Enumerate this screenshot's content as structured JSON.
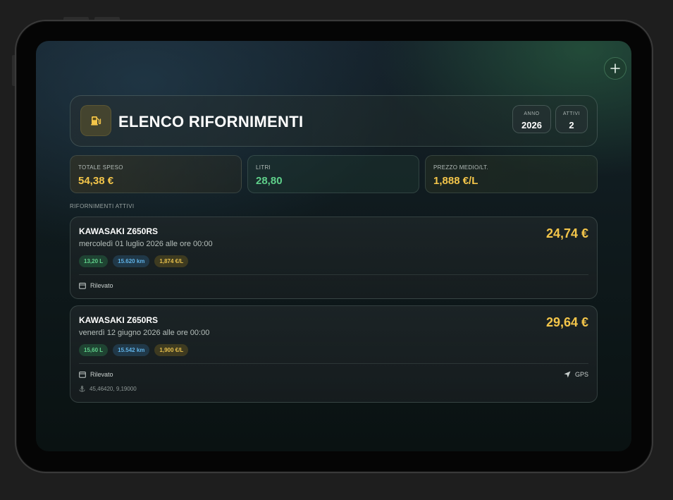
{
  "colors": {
    "accent_yellow": "#f3c54a",
    "accent_green": "#5fd08a",
    "accent_blue": "#5fb2e6"
  },
  "header": {
    "icon": "fuel-pump-icon",
    "title": "ELENCO RIFORNIMENTI",
    "year_label": "ANNO",
    "year_value": "2026",
    "active_label": "ATTIVI",
    "active_value": "2"
  },
  "add_button": {
    "icon": "plus-icon"
  },
  "stats": [
    {
      "label": "TOTALE SPESO",
      "value": "54,38 €",
      "color": "#f3c54a"
    },
    {
      "label": "LITRI",
      "value": "28,80",
      "color": "#5fd08a"
    },
    {
      "label": "PREZZO MEDIO/LT.",
      "value": "1,888 €/L",
      "color": "#f3c54a"
    }
  ],
  "section_label": "RIFORNIMENTI ATTIVI",
  "entries": [
    {
      "vehicle": "KAWASAKI Z650RS",
      "date": "mercoledì 01 luglio 2026 alle ore 00:00",
      "amount": "24,74 €",
      "liters": "13,20 L",
      "km": "15.620 km",
      "price": "1,874 €/L",
      "source": "Rilevato",
      "source_icon": "calendar-icon"
    },
    {
      "vehicle": "KAWASAKI Z650RS",
      "date": "venerdì 12 giugno 2026 alle ore 00:00",
      "amount": "29,64 €",
      "liters": "15,60 L",
      "km": "15.542 km",
      "price": "1,900 €/L",
      "source": "Rilevato",
      "source_icon": "calendar-icon",
      "location": "GPS",
      "location_icon": "location-arrow-icon",
      "coords": "45,46420, 9,19000",
      "coords_icon": "anchor-icon"
    }
  ]
}
